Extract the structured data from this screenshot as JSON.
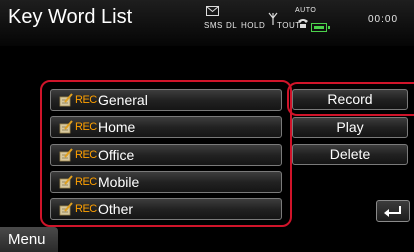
{
  "header": {
    "title": "Key Word List",
    "status": {
      "sms": "SMS",
      "dl": "DL",
      "hold": "HOLD",
      "tout": "TOUT",
      "auto": "AUTO",
      "clock": "00:00"
    }
  },
  "keywords": [
    {
      "rec": "REC",
      "label": "General"
    },
    {
      "rec": "REC",
      "label": "Home"
    },
    {
      "rec": "REC",
      "label": "Office"
    },
    {
      "rec": "REC",
      "label": "Mobile"
    },
    {
      "rec": "REC",
      "label": "Other"
    }
  ],
  "actions": {
    "record": "Record",
    "play": "Play",
    "delete": "Delete"
  },
  "footer": {
    "menu": "Menu"
  },
  "colors": {
    "highlight_frame": "#d0142a",
    "rec_text": "#ffa000",
    "battery": "#4bd24b"
  },
  "icons": {
    "keyword_icon": "pencil-note-icon",
    "back": "return-arrow-icon",
    "mail": "mail-icon",
    "signal": "antenna-icon",
    "phone": "phone-icon",
    "battery": "battery-icon"
  }
}
